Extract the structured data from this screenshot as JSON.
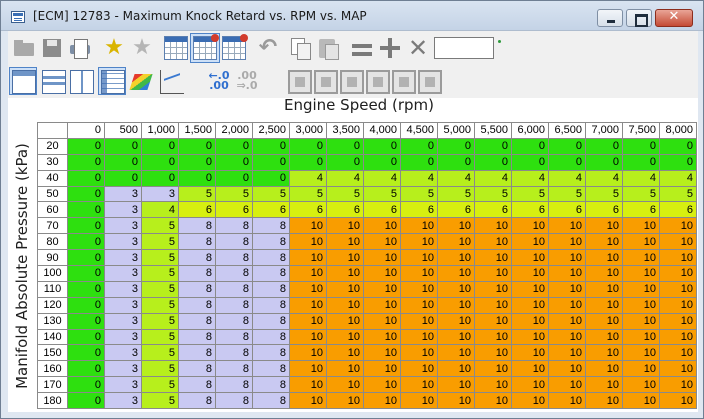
{
  "window": {
    "title": "[ECM] 12783 - Maximum Knock Retard vs. RPM vs. MAP",
    "buttons": {
      "close": "✕"
    }
  },
  "toolbar": {
    "row1_icons": [
      "open-folder-icon",
      "save-icon",
      "print-icon",
      "add-favorite-star-icon",
      "remove-favorite-star-icon",
      "grid-compare-icon",
      "grid-compare-select-icon",
      "grid-compare-red-icon",
      "undo-icon",
      "copy-icon",
      "paste-icon",
      "set-equal-icon",
      "add-icon",
      "clear-icon"
    ],
    "value_input": "",
    "row2_icons": [
      "view-table-icon",
      "view-split-h-icon",
      "view-split-v-icon",
      "view-grid-icon",
      "view-3d-icon",
      "view-line-chart-icon"
    ],
    "decimal_more": [
      "←.0",
      ".00"
    ],
    "decimal_less": [
      ".00",
      "⇒.0"
    ]
  },
  "map": {
    "x_axis_title": "Engine Speed (rpm)",
    "y_axis_title": "Manifold Absolute Pressure (kPa)",
    "columns": [
      "0",
      "500",
      "1,000",
      "1,500",
      "2,000",
      "2,500",
      "3,000",
      "3,500",
      "4,000",
      "4,500",
      "5,000",
      "5,500",
      "6,000",
      "6,500",
      "7,000",
      "7,500",
      "8,000"
    ],
    "rows": [
      {
        "label": "20",
        "values": [
          "0",
          "0",
          "0",
          "0",
          "0",
          "0",
          "0",
          "0",
          "0",
          "0",
          "0",
          "0",
          "0",
          "0",
          "0",
          "0",
          "0"
        ]
      },
      {
        "label": "30",
        "values": [
          "0",
          "0",
          "0",
          "0",
          "0",
          "0",
          "0",
          "0",
          "0",
          "0",
          "0",
          "0",
          "0",
          "0",
          "0",
          "0",
          "0"
        ]
      },
      {
        "label": "40",
        "values": [
          "0",
          "0",
          "0",
          "0",
          "0",
          "0",
          "4",
          "4",
          "4",
          "4",
          "4",
          "4",
          "4",
          "4",
          "4",
          "4",
          "4"
        ]
      },
      {
        "label": "50",
        "values": [
          "0",
          "3",
          "3",
          "5",
          "5",
          "5",
          "5",
          "5",
          "5",
          "5",
          "5",
          "5",
          "5",
          "5",
          "5",
          "5",
          "5"
        ]
      },
      {
        "label": "60",
        "values": [
          "0",
          "3",
          "4",
          "6",
          "6",
          "6",
          "6",
          "6",
          "6",
          "6",
          "6",
          "6",
          "6",
          "6",
          "6",
          "6",
          "6"
        ]
      },
      {
        "label": "70",
        "values": [
          "0",
          "3",
          "5",
          "8",
          "8",
          "8",
          "10",
          "10",
          "10",
          "10",
          "10",
          "10",
          "10",
          "10",
          "10",
          "10",
          "10"
        ]
      },
      {
        "label": "80",
        "values": [
          "0",
          "3",
          "5",
          "8",
          "8",
          "8",
          "10",
          "10",
          "10",
          "10",
          "10",
          "10",
          "10",
          "10",
          "10",
          "10",
          "10"
        ]
      },
      {
        "label": "90",
        "values": [
          "0",
          "3",
          "5",
          "8",
          "8",
          "8",
          "10",
          "10",
          "10",
          "10",
          "10",
          "10",
          "10",
          "10",
          "10",
          "10",
          "10"
        ]
      },
      {
        "label": "100",
        "values": [
          "0",
          "3",
          "5",
          "8",
          "8",
          "8",
          "10",
          "10",
          "10",
          "10",
          "10",
          "10",
          "10",
          "10",
          "10",
          "10",
          "10"
        ]
      },
      {
        "label": "110",
        "values": [
          "0",
          "3",
          "5",
          "8",
          "8",
          "8",
          "10",
          "10",
          "10",
          "10",
          "10",
          "10",
          "10",
          "10",
          "10",
          "10",
          "10"
        ]
      },
      {
        "label": "120",
        "values": [
          "0",
          "3",
          "5",
          "8",
          "8",
          "8",
          "10",
          "10",
          "10",
          "10",
          "10",
          "10",
          "10",
          "10",
          "10",
          "10",
          "10"
        ]
      },
      {
        "label": "130",
        "values": [
          "0",
          "3",
          "5",
          "8",
          "8",
          "8",
          "10",
          "10",
          "10",
          "10",
          "10",
          "10",
          "10",
          "10",
          "10",
          "10",
          "10"
        ]
      },
      {
        "label": "140",
        "values": [
          "0",
          "3",
          "5",
          "8",
          "8",
          "8",
          "10",
          "10",
          "10",
          "10",
          "10",
          "10",
          "10",
          "10",
          "10",
          "10",
          "10"
        ]
      },
      {
        "label": "150",
        "values": [
          "0",
          "3",
          "5",
          "8",
          "8",
          "8",
          "10",
          "10",
          "10",
          "10",
          "10",
          "10",
          "10",
          "10",
          "10",
          "10",
          "10"
        ]
      },
      {
        "label": "160",
        "values": [
          "0",
          "3",
          "5",
          "8",
          "8",
          "8",
          "10",
          "10",
          "10",
          "10",
          "10",
          "10",
          "10",
          "10",
          "10",
          "10",
          "10"
        ]
      },
      {
        "label": "170",
        "values": [
          "0",
          "3",
          "5",
          "8",
          "8",
          "8",
          "10",
          "10",
          "10",
          "10",
          "10",
          "10",
          "10",
          "10",
          "10",
          "10",
          "10"
        ]
      },
      {
        "label": "180",
        "values": [
          "0",
          "3",
          "5",
          "8",
          "8",
          "8",
          "10",
          "10",
          "10",
          "10",
          "10",
          "10",
          "10",
          "10",
          "10",
          "10",
          "10"
        ]
      }
    ],
    "cell_colors": {
      "0": "#2ee00f",
      "3": "#c9c9f2",
      "4": "#b7ef1c",
      "5": "#b7ef1c",
      "6": "#d7ef10",
      "8": "#c9c9f2",
      "10": "#f99d00"
    }
  }
}
